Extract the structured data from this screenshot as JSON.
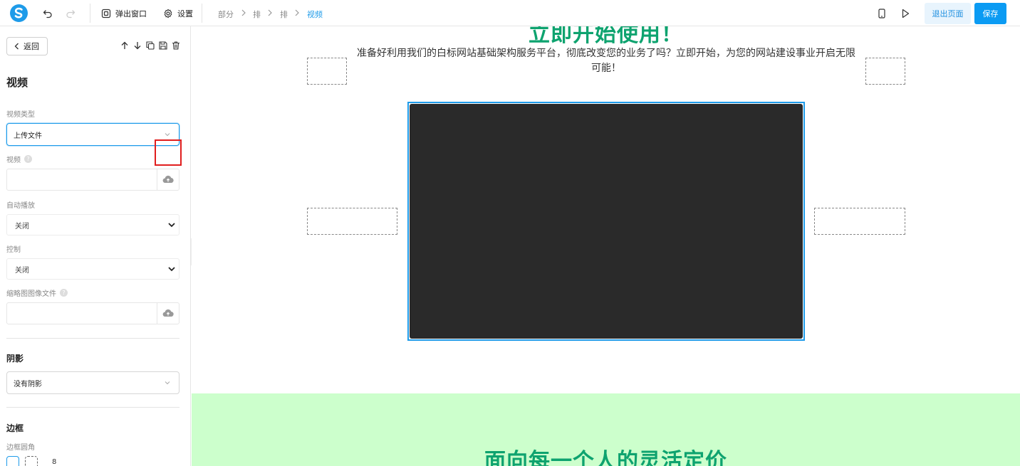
{
  "toolbar": {
    "popup_label": "弹出窗口",
    "settings_label": "设置",
    "exit_label": "退出页面",
    "save_label": "保存"
  },
  "breadcrumb": [
    "部分",
    "排",
    "排",
    "视频"
  ],
  "sidebar": {
    "back_label": "返回",
    "title": "视频",
    "video_type": {
      "label": "视频类型",
      "value": "上传文件"
    },
    "video": {
      "label": "视频",
      "help": "?"
    },
    "autoplay": {
      "label": "自动播放",
      "value": "关闭"
    },
    "controls": {
      "label": "控制",
      "value": "关闭"
    },
    "thumbnail": {
      "label": "缩略图图像文件",
      "help": "?"
    },
    "shadow": {
      "title": "阴影",
      "value": "没有阴影"
    },
    "border": {
      "title": "边框",
      "radius_label": "边框圆角",
      "radius_value": "8"
    }
  },
  "canvas": {
    "heading_top": "立即开始使用！",
    "subtitle": "准备好利用我们的白标网站基础架构服务平台，彻底改变您的业务了吗？立即开始，为您的网站建设事业开启无限可能！",
    "heading_bottom": "面向每一个人的灵活定价"
  },
  "colors": {
    "accent": "#1e9be9",
    "heading_green": "#0ea36f",
    "section_green": "#ccffcc",
    "video_bg": "#2a2a2a",
    "highlight": "#e01e1e"
  },
  "icons": [
    "logo-icon",
    "undo-icon",
    "redo-icon",
    "popup-icon",
    "gear-icon",
    "chevron-right-icon",
    "mobile-icon",
    "play-icon",
    "chevron-left-icon",
    "arrow-up-icon",
    "arrow-down-icon",
    "copy-icon",
    "save-icon",
    "trash-icon",
    "help-icon",
    "chevron-down-icon",
    "cloud-upload-icon"
  ]
}
